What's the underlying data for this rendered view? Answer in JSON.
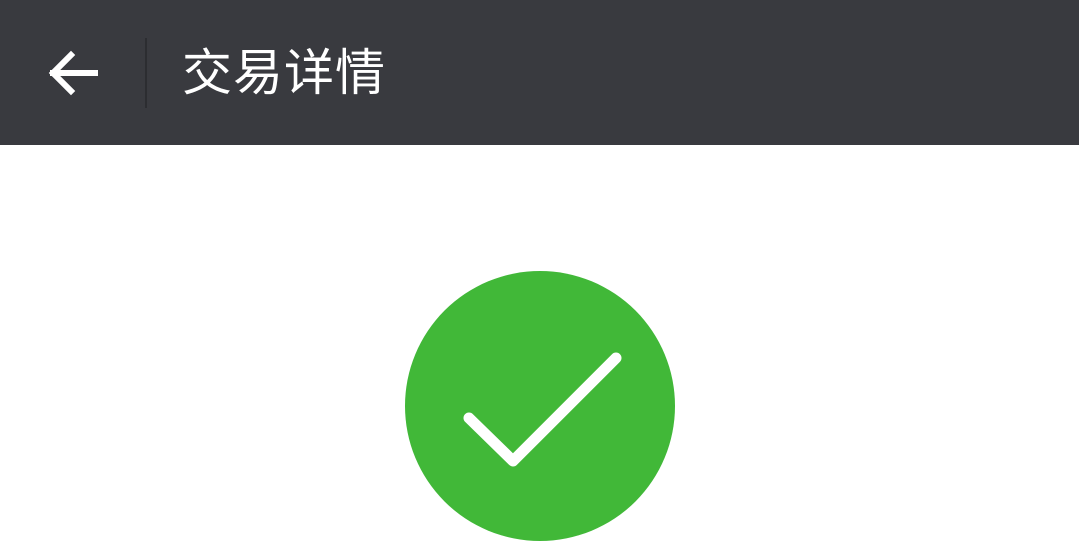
{
  "header": {
    "back_icon": "back-arrow-icon",
    "title": "交易详情",
    "background_color": "#393a3f",
    "text_color": "#ffffff"
  },
  "status": {
    "icon": "success-check-icon",
    "color": "#41b838"
  }
}
